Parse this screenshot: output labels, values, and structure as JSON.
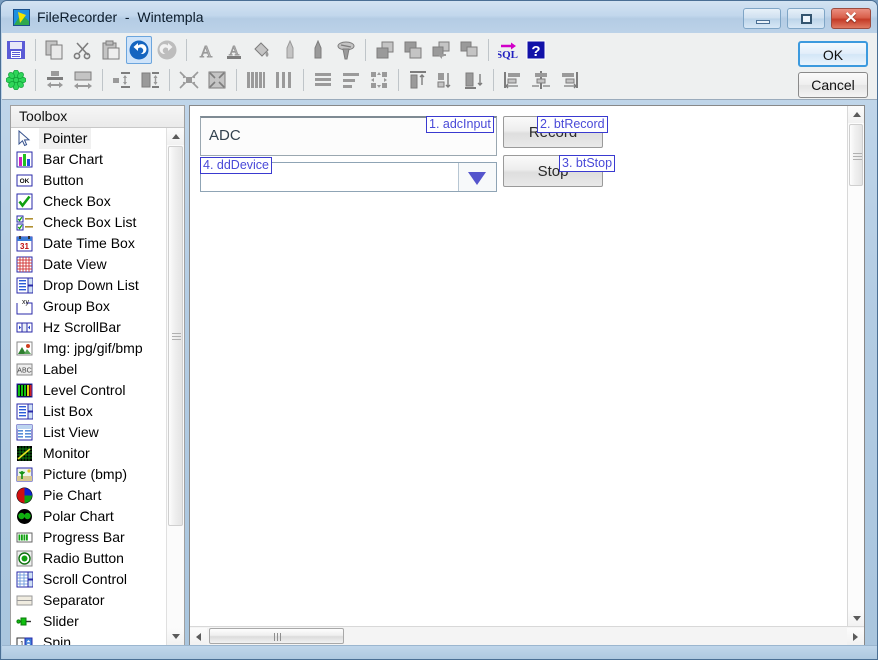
{
  "window": {
    "title": "FileRecorder  -  Wintempla",
    "app_icon": "wintempla-app-icon",
    "controls": {
      "minimize": "minimize-button",
      "maximize": "maximize-button",
      "close": "close-button",
      "close_glyph": "✕"
    }
  },
  "toolbar": {
    "row1": [
      {
        "name": "save-icon",
        "sep_after": true,
        "selected": false
      },
      {
        "name": "copy-icon",
        "sep_after": false,
        "selected": false
      },
      {
        "name": "cut-scissors-icon",
        "sep_after": false,
        "selected": false
      },
      {
        "name": "paste-icon",
        "sep_after": false,
        "selected": false
      },
      {
        "name": "undo-icon",
        "sep_after": false,
        "selected": true
      },
      {
        "name": "redo-icon",
        "sep_after": true,
        "selected": false
      },
      {
        "name": "font-icon",
        "sep_after": false,
        "selected": false
      },
      {
        "name": "font-color-icon",
        "sep_after": false,
        "selected": false
      },
      {
        "name": "fill-color-icon",
        "sep_after": false,
        "selected": false
      },
      {
        "name": "pen-icon",
        "sep_after": false,
        "selected": false
      },
      {
        "name": "pencil-icon",
        "sep_after": false,
        "selected": false
      },
      {
        "name": "screw-icon",
        "sep_after": true,
        "selected": false
      },
      {
        "name": "bring-to-front-icon",
        "sep_after": false,
        "selected": false
      },
      {
        "name": "send-to-back-icon",
        "sep_after": false,
        "selected": false
      },
      {
        "name": "bring-forward-icon",
        "sep_after": false,
        "selected": false
      },
      {
        "name": "send-backward-icon",
        "sep_after": true,
        "selected": false
      },
      {
        "name": "sql-icon",
        "sep_after": false,
        "selected": false
      },
      {
        "name": "help-icon",
        "sep_after": false,
        "selected": false
      }
    ],
    "row2": [
      {
        "name": "snowflake-icon",
        "sep_after": true,
        "selected": false
      },
      {
        "name": "make-same-width-icon",
        "sep_after": false,
        "selected": false
      },
      {
        "name": "make-same-height-icon",
        "sep_after": true,
        "selected": false
      },
      {
        "name": "size-to-grid-width-icon",
        "sep_after": false,
        "selected": false
      },
      {
        "name": "size-to-grid-height-icon",
        "sep_after": true,
        "selected": false
      },
      {
        "name": "shrink-horizontal-icon",
        "sep_after": false,
        "selected": false
      },
      {
        "name": "shrink-all-icon",
        "sep_after": true,
        "selected": false
      },
      {
        "name": "distribute-vertical-icon",
        "sep_after": false,
        "selected": false
      },
      {
        "name": "distribute-horizontal-icon",
        "sep_after": true,
        "selected": false
      },
      {
        "name": "align-justify-icon",
        "sep_after": false,
        "selected": false
      },
      {
        "name": "align-rows-icon",
        "sep_after": false,
        "selected": false
      },
      {
        "name": "center-in-form-icon",
        "sep_after": true,
        "selected": false
      },
      {
        "name": "align-top-icon",
        "sep_after": false,
        "selected": false
      },
      {
        "name": "align-middle-icon",
        "sep_after": false,
        "selected": false
      },
      {
        "name": "align-bottom-icon",
        "sep_after": true,
        "selected": false
      },
      {
        "name": "align-left-icon",
        "sep_after": false,
        "selected": false
      },
      {
        "name": "align-center-icon",
        "sep_after": false,
        "selected": false
      },
      {
        "name": "align-right-icon",
        "sep_after": false,
        "selected": false
      }
    ]
  },
  "dialog_buttons": {
    "ok_label": "OK",
    "cancel_label": "Cancel"
  },
  "toolbox": {
    "header": "Toolbox",
    "items": [
      {
        "label": "Pointer",
        "icon": "pointer-icon",
        "selected": true
      },
      {
        "label": "Bar Chart",
        "icon": "bar-chart-icon",
        "selected": false
      },
      {
        "label": "Button",
        "icon": "button-icon",
        "selected": false
      },
      {
        "label": "Check Box",
        "icon": "check-box-icon",
        "selected": false
      },
      {
        "label": "Check Box List",
        "icon": "check-box-list-icon",
        "selected": false
      },
      {
        "label": "Date Time Box",
        "icon": "date-time-box-icon",
        "selected": false
      },
      {
        "label": "Date View",
        "icon": "date-view-icon",
        "selected": false
      },
      {
        "label": "Drop Down List",
        "icon": "drop-down-list-icon",
        "selected": false
      },
      {
        "label": "Group Box",
        "icon": "group-box-icon",
        "selected": false
      },
      {
        "label": "Hz ScrollBar",
        "icon": "hz-scrollbar-icon",
        "selected": false
      },
      {
        "label": "Img: jpg/gif/bmp",
        "icon": "image-icon",
        "selected": false
      },
      {
        "label": "Label",
        "icon": "label-icon",
        "selected": false
      },
      {
        "label": "Level Control",
        "icon": "level-control-icon",
        "selected": false
      },
      {
        "label": "List Box",
        "icon": "list-box-icon",
        "selected": false
      },
      {
        "label": "List View",
        "icon": "list-view-icon",
        "selected": false
      },
      {
        "label": "Monitor",
        "icon": "monitor-icon",
        "selected": false
      },
      {
        "label": "Picture (bmp)",
        "icon": "picture-bmp-icon",
        "selected": false
      },
      {
        "label": "Pie Chart",
        "icon": "pie-chart-icon",
        "selected": false
      },
      {
        "label": "Polar Chart",
        "icon": "polar-chart-icon",
        "selected": false
      },
      {
        "label": "Progress Bar",
        "icon": "progress-bar-icon",
        "selected": false
      },
      {
        "label": "Radio Button",
        "icon": "radio-button-icon",
        "selected": false
      },
      {
        "label": "Scroll Control",
        "icon": "scroll-control-icon",
        "selected": false
      },
      {
        "label": "Separator",
        "icon": "separator-icon",
        "selected": false
      },
      {
        "label": "Slider",
        "icon": "slider-icon",
        "selected": false
      },
      {
        "label": "Spin",
        "icon": "spin-icon",
        "selected": false
      }
    ]
  },
  "design": {
    "controls": [
      {
        "name": "adcInput",
        "text": "ADC",
        "tag": "1. adcInput",
        "type": "textbox"
      },
      {
        "name": "btRecord",
        "text": "Record",
        "tag": "2. btRecord",
        "type": "button"
      },
      {
        "name": "btStop",
        "text": "Stop",
        "tag": "3. btStop",
        "type": "button"
      },
      {
        "name": "ddDevice",
        "text": "",
        "tag": "4. ddDevice",
        "type": "dropdown"
      }
    ]
  },
  "colors": {
    "tag_border": "#3a3ad0",
    "tag_text": "#4a4ad8",
    "selection_blue": "#3c9ade",
    "title_bar": "#c2d7ec",
    "toolbar_bg": "#eef0f0"
  }
}
